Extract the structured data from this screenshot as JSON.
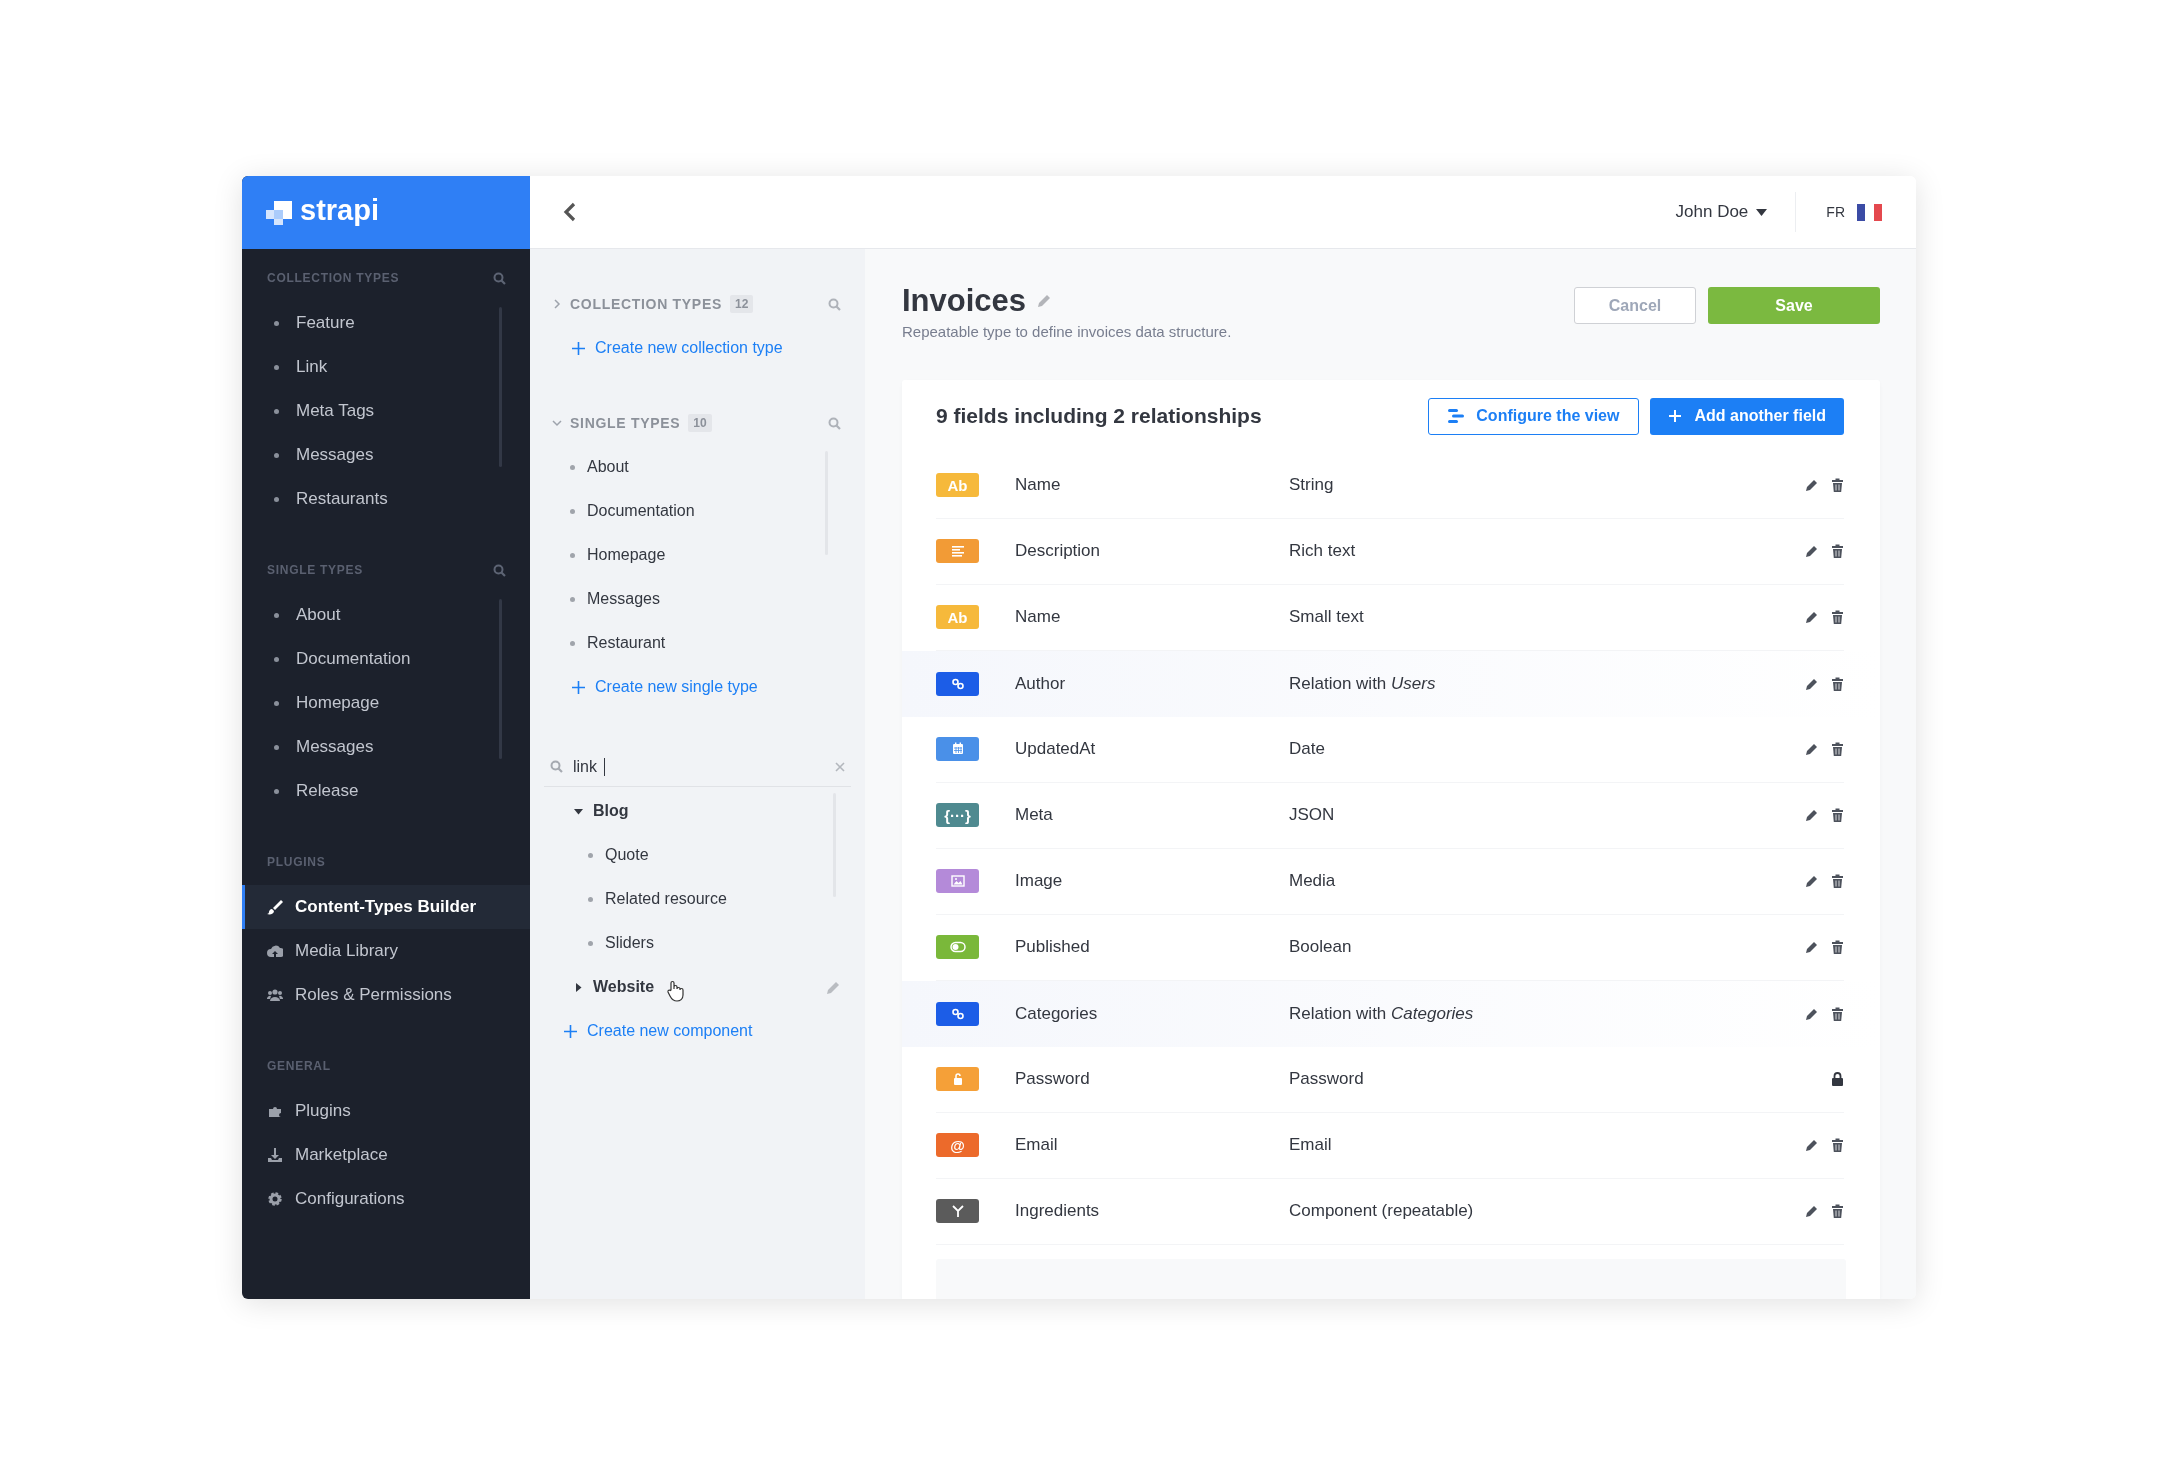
{
  "logo": "strapi",
  "sidebar": {
    "sections": [
      {
        "title": "COLLECTION TYPES",
        "kind": "list",
        "searchable": true,
        "items": [
          {
            "label": "Feature",
            "selected": false
          },
          {
            "label": "Link",
            "selected": false
          },
          {
            "label": "Meta Tags",
            "selected": false
          },
          {
            "label": "Messages",
            "selected": false
          },
          {
            "label": "Restaurants",
            "selected": false
          }
        ]
      },
      {
        "title": "SINGLE TYPES",
        "kind": "list",
        "searchable": true,
        "items": [
          {
            "label": "About",
            "selected": false
          },
          {
            "label": "Documentation",
            "selected": false
          },
          {
            "label": "Homepage",
            "selected": false
          },
          {
            "label": "Messages",
            "selected": false
          },
          {
            "label": "Release",
            "selected": false
          }
        ]
      },
      {
        "title": "PLUGINS",
        "kind": "menu",
        "searchable": false,
        "items": [
          {
            "label": "Content-Types Builder",
            "selected": true
          },
          {
            "label": "Media Library",
            "selected": false
          },
          {
            "label": "Roles & Permissions",
            "selected": false
          }
        ]
      },
      {
        "title": "GENERAL",
        "kind": "menu",
        "searchable": false,
        "items": [
          {
            "label": "Plugins",
            "selected": false
          },
          {
            "label": "Marketplace",
            "selected": false
          },
          {
            "label": "Configurations",
            "selected": false
          }
        ]
      }
    ]
  },
  "header": {
    "user": "John Doe",
    "language": "FR"
  },
  "builder": {
    "groups": [
      {
        "title": "COLLECTION TYPES",
        "count": "12",
        "expanded": false,
        "create_link": "Create new collection type"
      },
      {
        "title": "SINGLE TYPES",
        "count": "10",
        "expanded": true,
        "items": [
          "About",
          "Documentation",
          "Homepage",
          "Messages",
          "Restaurant"
        ],
        "create_link": "Create new single type"
      }
    ],
    "components": {
      "search": {
        "value": "link"
      },
      "tree": [
        {
          "label": "Blog",
          "expanded": true,
          "hovered": false,
          "children": [
            {
              "label": "Quote"
            },
            {
              "label": "Related resource"
            },
            {
              "label": "Sliders"
            }
          ]
        },
        {
          "label": "Website",
          "expanded": false,
          "hovered": true
        }
      ],
      "create_link": "Create new component"
    }
  },
  "content_type": {
    "title": "Invoices",
    "description": "Repeatable type to define invoices data structure.",
    "cancel": "Cancel",
    "save": "Save"
  },
  "fields_card": {
    "title": "9 fields including 2 relationships",
    "configure": "Configure the view",
    "add": "Add another field",
    "fields": [
      {
        "name": "Name",
        "type": "String",
        "kind": "text",
        "badge": "Ab",
        "color": "#f6b93b",
        "highlighted": false,
        "locked": false
      },
      {
        "name": "Description",
        "type": "Rich text",
        "kind": "richtext",
        "color": "#f29b36",
        "highlighted": false,
        "locked": false
      },
      {
        "name": "Name",
        "type": "Small text",
        "kind": "text",
        "badge": "Ab",
        "color": "#f6b93b",
        "highlighted": false,
        "locked": false
      },
      {
        "name": "Author",
        "type": "Relation with *Users*",
        "kind": "relation",
        "color": "#1c5de7",
        "highlighted": true,
        "locked": false
      },
      {
        "name": "UpdatedAt",
        "type": "Date",
        "kind": "date",
        "color": "#4a90e8",
        "highlighted": false,
        "locked": false
      },
      {
        "name": "Meta",
        "type": "JSON",
        "kind": "text",
        "badge": "{···}",
        "color": "#4f8a90",
        "highlighted": false,
        "locked": false
      },
      {
        "name": "Image",
        "type": "Media",
        "kind": "media",
        "color": "#b48ad9",
        "highlighted": false,
        "locked": false
      },
      {
        "name": "Published",
        "type": "Boolean",
        "kind": "boolean",
        "color": "#7ab83a",
        "highlighted": false,
        "locked": false
      },
      {
        "name": "Categories",
        "type": "Relation with *Categories*",
        "kind": "relation",
        "color": "#1c5de7",
        "highlighted": true,
        "locked": false
      },
      {
        "name": "Password",
        "type": "Password",
        "kind": "password",
        "color": "#f5a038",
        "highlighted": false,
        "locked": true
      },
      {
        "name": "Email",
        "type": "Email",
        "kind": "text",
        "badge": "@",
        "color": "#ec6a2b",
        "highlighted": false,
        "locked": false
      },
      {
        "name": "Ingredients",
        "type": "Component (repeatable)",
        "kind": "component",
        "color": "#5b5b5b",
        "highlighted": false,
        "locked": false
      }
    ]
  }
}
